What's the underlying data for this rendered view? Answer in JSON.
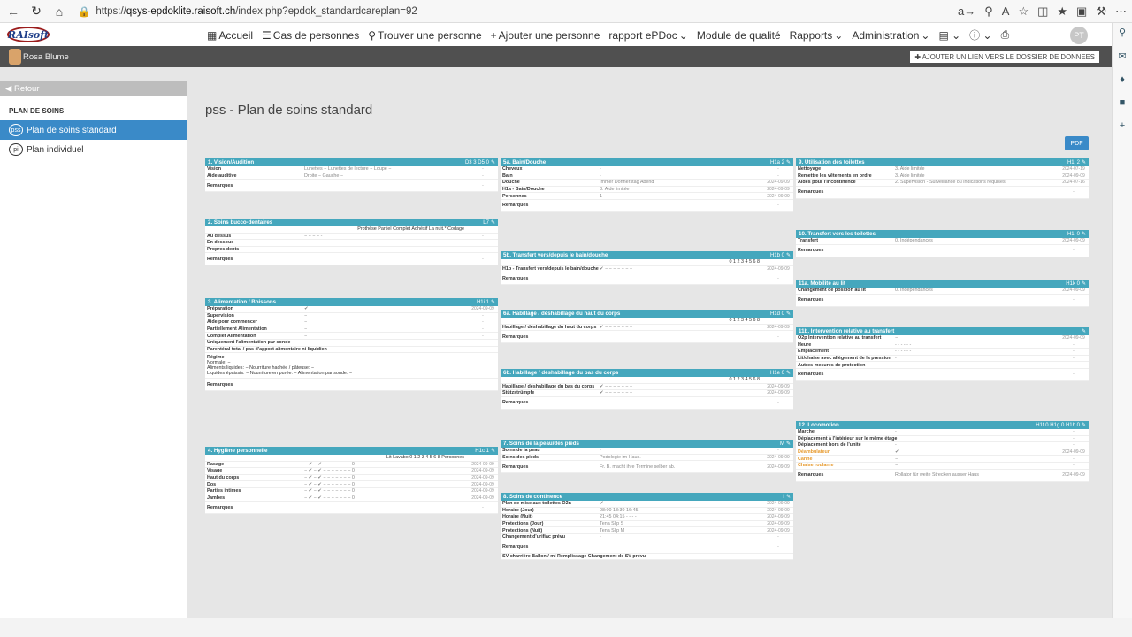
{
  "browser": {
    "url_prefix": "https://",
    "host": "qsys-epdoklite.raisoft.ch",
    "path": "/index.php?epdok_standardcareplan=92"
  },
  "app": {
    "logo": "RAIsoft",
    "user": "Rosa Blume",
    "avatar_initials": "PT",
    "dossier_link": "AJOUTER UN LIEN VERS LE DOSSIER DE DONNEES"
  },
  "menu": [
    "Accueil",
    "Cas de personnes",
    "Trouver une personne",
    "Ajouter une personne",
    "rapport ePDoc",
    "Module de qualité",
    "Rapports",
    "Administration"
  ],
  "sidebar": {
    "back": "Retour",
    "section": "PLAN DE SOINS",
    "items": [
      {
        "badge": "pss",
        "label": "Plan de soins standard"
      },
      {
        "badge": "pi",
        "label": "Plan individuel"
      }
    ]
  },
  "page": {
    "title": "pss - Plan de soins standard",
    "pdf": "PDF"
  },
  "cards": {
    "c1": {
      "title": "1. Vision/Audition",
      "tags": "D3 3 D5 0",
      "rows": [
        [
          "Vision",
          "Lunettes  −     Lunettes de lecture  −     Loupe  −",
          "-"
        ],
        [
          "Aide auditive",
          "Droite  −     Gauche  −",
          "-"
        ],
        [
          "Remarques",
          "",
          "-"
        ]
      ]
    },
    "c2": {
      "title": "2. Soins bucco-dentaires",
      "tags": "L7",
      "head": "Prothèse   Partiel   Complet   Adhésif   La nuit.*   Codage",
      "rows": [
        [
          "Au dessus",
          "−   −   −   −   -",
          "-"
        ],
        [
          "En dessous",
          "−   −   −   −   -",
          "-"
        ],
        [
          "Propres dents",
          "",
          "-"
        ],
        [
          "Remarques",
          "",
          "-"
        ]
      ]
    },
    "c3": {
      "title": "3. Alimentation / Boissons",
      "tags": "H1i 1",
      "rows": [
        [
          "Préparation",
          "✔",
          "2024-09-09"
        ],
        [
          "Supervision",
          "−",
          "-"
        ],
        [
          "Aide pour commencer",
          "−",
          "-"
        ],
        [
          "Partiellement Alimentation",
          "−",
          "-"
        ],
        [
          "Complet Alimentation",
          "−",
          "-"
        ],
        [
          "Uniquement l'alimentation par sonde",
          "−",
          "-"
        ],
        [
          "Parentéral total / pas d'apport alimentaire ni liquidien",
          "−",
          "-"
        ]
      ],
      "regime": [
        "Régime",
        "Normale: −",
        "Aliments liquides: −   Nourriture hachée / pâteuse: −",
        "Liquides épaissis: −   Nourriture en purée: −   Alimentation par sonde: −"
      ],
      "remark": "Remarques"
    },
    "c4": {
      "title": "4. Hygiène personnelle",
      "tags": "H1c 1",
      "head": "Lit   Lavabo   0  1  2  3  4  5  6  8   Personnes",
      "rows": [
        [
          "Rasage",
          "−  ✔  − ✔ − − − − − −  −   0",
          "2024-09-09"
        ],
        [
          "Visage",
          "−  ✔  − ✔ − − − − − −  −   0",
          "2024-09-09"
        ],
        [
          "Haut du corps",
          "−  ✔  − ✔ − − − − − −  −   0",
          "2024-09-09"
        ],
        [
          "Dos",
          "−  ✔  − ✔ − − − − − −  −   0",
          "2024-09-09"
        ],
        [
          "Parties intimes",
          "−  ✔  − ✔ − − − − − −  −   0",
          "2024-09-09"
        ],
        [
          "Jambes",
          "−  ✔  − ✔ − − − − − −  −   0",
          "2024-09-09"
        ],
        [
          "Remarques",
          "",
          "-"
        ]
      ]
    },
    "c5a": {
      "title": "5a. Bain/Douche",
      "tags": "H1a 2",
      "rows": [
        [
          "Cheveux",
          "-",
          "-"
        ],
        [
          "Bain",
          "-",
          "-"
        ],
        [
          "Douche",
          "Immer Donnerstag Abend",
          "2024-09-09"
        ],
        [
          "H1a - Bain/Douche",
          "3. Aide limitée",
          "2024-09-09"
        ],
        [
          "Personnes",
          "1",
          "2024-09-09"
        ],
        [
          "Remarques",
          "",
          "-"
        ]
      ]
    },
    "c5b": {
      "title": "5b. Transfert vers/depuis le bain/douche",
      "tags": "H1b 0",
      "head": "0  1  2  3  4  5  6  8",
      "rows": [
        [
          "H1b - Transfert vers/depuis le bain/douche",
          "✔ − − − − − − −",
          "2024-09-09"
        ],
        [
          "Remarques",
          "",
          "-"
        ]
      ]
    },
    "c6a": {
      "title": "6a. Habillage / déshabillage du haut du corps",
      "tags": "H1d 0",
      "head": "0  1  2  3  4  5  6  8",
      "rows": [
        [
          "Habillage / déshabillage du haut du corps",
          "✔ − − − − − − −",
          "2024-09-09"
        ],
        [
          "Remarques",
          "",
          "-"
        ]
      ]
    },
    "c6b": {
      "title": "6b. Habillage / déshabillage du bas du corps",
      "tags": "H1e 0",
      "head": "0  1  2  3  4  5  6  8",
      "rows": [
        [
          "Habillage / déshabillage du bas du corps",
          "✔ − − − − − − −",
          "2024-09-09"
        ],
        [
          "Stützstrümpfe",
          "✔ − − − − − − −",
          "2024-09-09"
        ],
        [
          "Remarques",
          "",
          "-"
        ]
      ]
    },
    "c7": {
      "title": "7. Soins de la peau/des pieds",
      "tags": "M",
      "rows": [
        [
          "Soins de la peau",
          "-",
          "-"
        ],
        [
          "Soins des pieds",
          "Podologie im Haus.",
          "2024-09-09"
        ],
        [
          "Remarques",
          "Fr. B. macht ihre Termine selber ab.",
          "2024-09-09"
        ]
      ]
    },
    "c8": {
      "title": "8. Soins de continence",
      "tags": "I",
      "rows": [
        [
          "Plan de mise aux toilettes O2n",
          "✔",
          "2024-09-09"
        ],
        [
          "Horaire (Jour)",
          "08:00   13:30   16:45   -   -   -",
          "2024-09-09"
        ],
        [
          "Horaire (Nuit)",
          "21:45   04:15   -   -   -   -",
          "2024-09-09"
        ],
        [
          "Protections (Jour)",
          "Tena Slip S",
          "2024-09-09"
        ],
        [
          "Protections (Nuit)",
          "Tena Slip M",
          "2024-09-09"
        ],
        [
          "Changement d'urifiac prévu",
          "-",
          "-"
        ],
        [
          "Remarques",
          "",
          "-"
        ],
        [
          "SV charrière    Ballon / ml    Remplissage    Changement de SV prévu",
          "",
          "-"
        ]
      ]
    },
    "c9": {
      "title": "9. Utilisation des toilettes",
      "tags": "H1j 2",
      "rows": [
        [
          "Nettoyage",
          "3. Aide limitée",
          "2024-07-19"
        ],
        [
          "Remettre les vêtements en ordre",
          "3. Aide limitée",
          "2024-09-09"
        ],
        [
          "Aides pour l'incontinence",
          "2. Supervision - Surveillance ou indications requises",
          "2024-07-16"
        ],
        [
          "Remarques",
          "",
          "-"
        ]
      ]
    },
    "c10": {
      "title": "10. Transfert vers les toilettes",
      "tags": "H1i 0",
      "rows": [
        [
          "Transfert",
          "0. Indépendances",
          "2024-09-09"
        ],
        [
          "Remarques",
          "",
          "-"
        ]
      ]
    },
    "c11a": {
      "title": "11a. Mobilité au lit",
      "tags": "H1k 0",
      "rows": [
        [
          "Changement de position au lit",
          "0. Indépendances",
          "2024-09-09"
        ],
        [
          "Remarques",
          "",
          "-"
        ]
      ]
    },
    "c11b": {
      "title": "11b. Intervention relative au transfert",
      "tags": "",
      "rows": [
        [
          "O2p Intervention relative au transfert",
          "−",
          "2024-09-09"
        ],
        [
          "Heure",
          "- - - - - -",
          "-"
        ],
        [
          "Emplacement",
          "- - - - - -",
          "-"
        ],
        [
          "Lit/chaise avec allègement de la pression",
          "-",
          "-"
        ],
        [
          "Autres mesures de protection",
          "-",
          "-"
        ],
        [
          "Remarques",
          "",
          "-"
        ]
      ]
    },
    "c12": {
      "title": "12. Locomotion",
      "tags": "H1f 0 H1g 0 H1h 0",
      "rows": [
        [
          "Marche",
          "-",
          "-"
        ],
        [
          "Déplacement à l'intérieur sur le même étage",
          "-",
          "-"
        ],
        [
          "Déplacement hors de l'unité",
          "-",
          "-"
        ],
        [
          "Déambulateur",
          "✔",
          "2024-09-09"
        ],
        [
          "Canne",
          "−",
          "-"
        ],
        [
          "Chaise roulante",
          "−",
          "-"
        ],
        [
          "Remarques",
          "Rollator für weite Strecken ausser Haus",
          "2024-09-09"
        ]
      ]
    }
  }
}
